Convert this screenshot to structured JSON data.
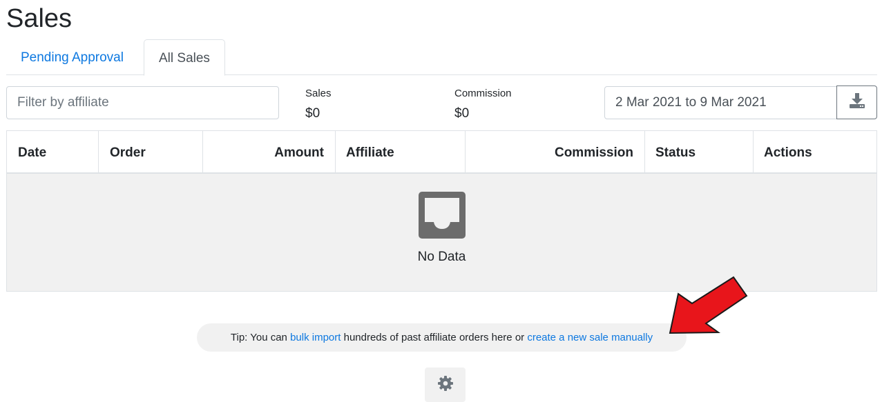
{
  "page": {
    "title": "Sales"
  },
  "tabs": [
    {
      "label": "Pending Approval",
      "active": false
    },
    {
      "label": "All Sales",
      "active": true
    }
  ],
  "filter": {
    "placeholder": "Filter by affiliate",
    "value": ""
  },
  "stats": {
    "sales": {
      "label": "Sales",
      "value": "$0"
    },
    "commission": {
      "label": "Commission",
      "value": "$0"
    }
  },
  "date_range": {
    "value": "2 Mar 2021 to 9 Mar 2021"
  },
  "toolbar": {
    "download_icon": "download-icon"
  },
  "table": {
    "columns": [
      "Date",
      "Order",
      "Amount",
      "Affiliate",
      "Commission",
      "Status",
      "Actions"
    ],
    "empty_icon": "inbox-icon",
    "empty_text": "No Data"
  },
  "tip": {
    "prefix": "Tip: You can ",
    "link1": "bulk import",
    "middle": " hundreds of past affiliate orders here or ",
    "link2": "create a new sale manually"
  },
  "annotation": {
    "arrow_color": "#e8151b",
    "icon": "arrow-icon"
  },
  "settings": {
    "icon": "gear-icon"
  },
  "colors": {
    "link": "#0d78e0",
    "border": "#dee2e6",
    "empty_bg": "#f1f1f1"
  }
}
